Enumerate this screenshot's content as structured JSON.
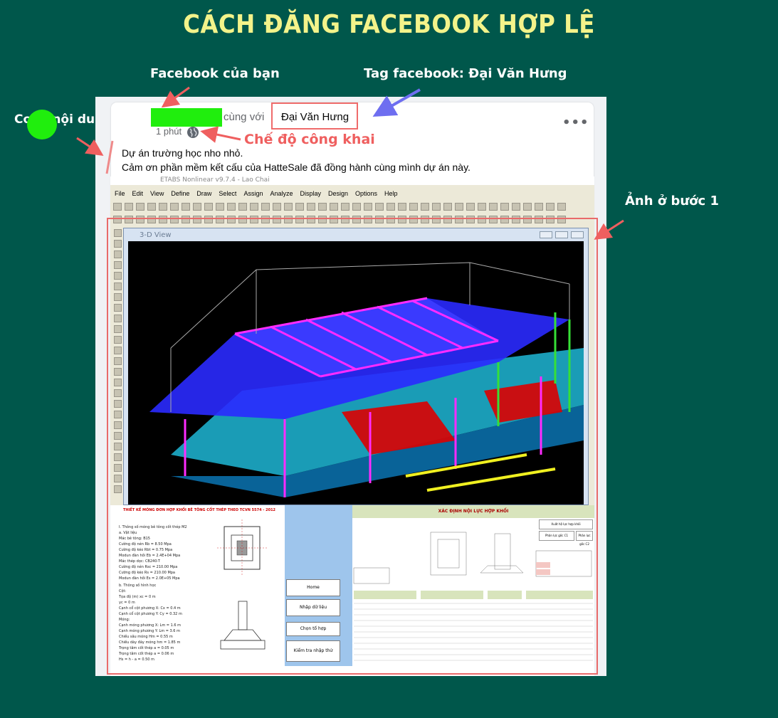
{
  "heading": "CÁCH ĐĂNG FACEBOOK HỢP LỆ",
  "annotations": {
    "facebook_cua_ban": "Facebook của bạn",
    "tag_facebook": "Tag facebook: Đại Văn Hưng",
    "copy_noi_dung": "Copy nội dung",
    "che_do_cong_khai": "Chế độ công khai",
    "anh_o_buoc_1": "Ảnh ở bước 1"
  },
  "post": {
    "with_text": "cùng với",
    "tagged_name": "Đại Văn Hưng",
    "time": "1 phút",
    "privacy_icon": "globe-icon",
    "more_icon": "more-options-icon",
    "more_label": "•••",
    "line1": "Dự án trường học nho nhỏ.",
    "line2": "Cảm ơn phần mềm kết cấu của HatteSale đã đồng hành cùng mình dự án này."
  },
  "etabs": {
    "title": "ETABS Nonlinear v9.7.4 - Lao Chai",
    "menu": [
      "File",
      "Edit",
      "View",
      "Define",
      "Draw",
      "Select",
      "Assign",
      "Analyze",
      "Display",
      "Design",
      "Options",
      "Help"
    ],
    "view_title": "3-D View"
  },
  "spreadsheet": {
    "left_title": "THIẾT KẾ MÓNG ĐƠN HỢP KHỐI BÊ TÔNG CỐT THÉP THEO TCVN 5574 - 2012",
    "left_rows": [
      "I. Thông số móng bê tông cốt thép   M2",
      "a. Vật liệu",
      "Mác bê tông:   B15",
      "Cường độ nén   Rb =  8.50   Mpa",
      "Cường độ kéo   Rbt =  0.75   Mpa",
      "Modun đàn hồi   Eb =  2.4E+04   Mpa",
      "Mác thép dọc:   CB240-T",
      "Cường độ nén   Rsc =  210.00   Mpa",
      "Cường độ kéo   Rs =  210.00   Mpa",
      "Modun đàn hồi   Es =  2.0E+05   Mpa",
      "b. Thông số hình học",
      "Cột:",
      "Tọa độ (m)   xc =  0   m",
      "   yc =  0   m",
      "Cạnh cổ cột phương X:   Cx =  0.4   m",
      "Cạnh cổ cột phương Y:   Cy =  0.32   m",
      "Móng:",
      "Cạnh móng phương X:   Lm =  1.6   m",
      "Cạnh móng phương Y:   Lm =  3.6   m",
      "Chiều sâu móng   Hm =  0.55   m",
      "Chiều dày đáy móng   hm =  1.85   m",
      "Trọng tâm cốt thép   a =  0.05   m",
      "Trọng tâm cốt thép   a =  0.06   m",
      "Hs = h - a   =  0.50   m"
    ],
    "nav_buttons": [
      "Home",
      "Nhập dữ liệu",
      "Chọn tổ hợp",
      "Kiểm tra nhập thử"
    ],
    "right_title": "XÁC ĐỊNH NỘI LỰC HỢP KHỐI",
    "right_buttons": [
      "Xuất hệ lực hợp khối",
      "Phân lực gốc C1",
      "Phân lực gốc C2"
    ]
  },
  "colors": {
    "background": "#00574b",
    "heading": "#f3f38a",
    "annotation_red": "#ef5f5f",
    "arrow_blue": "#6e6ef0",
    "highlight_green": "#20ee0d"
  }
}
